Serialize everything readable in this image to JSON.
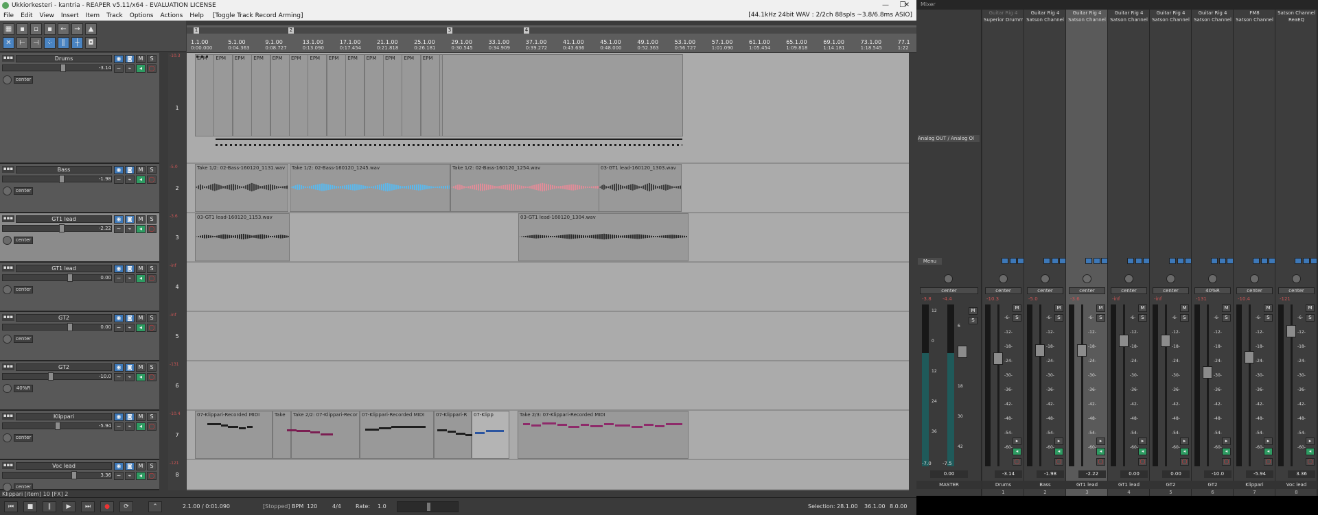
{
  "window": {
    "title": "Ukkiorkesteri - kantria - REAPER v5.11/x64 - EVALUATION LICENSE",
    "status": "[44.1kHz 24bit WAV : 2/2ch 88spls ~3.8/6.8ms ASIO]",
    "minimize": "—",
    "restore": "❐",
    "close": "✕"
  },
  "menu": {
    "items": [
      "File",
      "Edit",
      "View",
      "Insert",
      "Item",
      "Track",
      "Options",
      "Actions",
      "Help"
    ],
    "arming": "[Toggle Track Record Arming]"
  },
  "toolbar": {
    "icons": [
      "grid-icon",
      "save-icon",
      "open-icon",
      "new-icon",
      "undo-icon",
      "redo-icon",
      "metronome-icon",
      "ripple-icon",
      "snap-icon",
      "lock-icon",
      "group-icon",
      "envelope-icon",
      "crosshair-icon",
      "split-icon"
    ]
  },
  "ruler": {
    "markers": [
      "1",
      "2",
      "3",
      "4"
    ],
    "ticks": [
      {
        "bar": "1.1.00",
        "time": "0:00.000"
      },
      {
        "bar": "5.1.00",
        "time": "0:04.363"
      },
      {
        "bar": "9.1.00",
        "time": "0:08.727"
      },
      {
        "bar": "13.1.00",
        "time": "0:13.090"
      },
      {
        "bar": "17.1.00",
        "time": "0:17.454"
      },
      {
        "bar": "21.1.00",
        "time": "0:21.818"
      },
      {
        "bar": "25.1.00",
        "time": "0:26.181"
      },
      {
        "bar": "29.1.00",
        "time": "0:30.545"
      },
      {
        "bar": "33.1.00",
        "time": "0:34.909"
      },
      {
        "bar": "37.1.00",
        "time": "0:39.272"
      },
      {
        "bar": "41.1.00",
        "time": "0:43.636"
      },
      {
        "bar": "45.1.00",
        "time": "0:48.000"
      },
      {
        "bar": "49.1.00",
        "time": "0:52.363"
      },
      {
        "bar": "53.1.00",
        "time": "0:56.727"
      },
      {
        "bar": "57.1.00",
        "time": "1:01.090"
      },
      {
        "bar": "61.1.00",
        "time": "1:05.454"
      },
      {
        "bar": "65.1.00",
        "time": "1:09.818"
      },
      {
        "bar": "69.1.00",
        "time": "1:14.181"
      },
      {
        "bar": "73.1.00",
        "time": "1:18.545"
      },
      {
        "bar": "77.1",
        "time": "1:22"
      }
    ]
  },
  "tracks": [
    {
      "name": "Drums",
      "vol": "-3.14",
      "pan": "center",
      "num": "1",
      "peak": "-10.3",
      "lane_h": 162
    },
    {
      "name": "Bass",
      "vol": "-1.98",
      "pan": "center",
      "num": "2",
      "peak": "-5.0",
      "lane_h": 72
    },
    {
      "name": "GT1 lead",
      "vol": "-2.22",
      "pan": "center",
      "num": "3",
      "peak": "-3.6",
      "lane_h": 72
    },
    {
      "name": "GT1 lead",
      "vol": "0.00",
      "pan": "center",
      "num": "4",
      "peak": "-inf",
      "lane_h": 72
    },
    {
      "name": "GT2",
      "vol": "0.00",
      "pan": "center",
      "num": "5",
      "peak": "-inf",
      "lane_h": 72
    },
    {
      "name": "GT2",
      "vol": "-10.0",
      "pan": "40%R",
      "num": "6",
      "peak": "-131",
      "lane_h": 72
    },
    {
      "name": "Klippari",
      "vol": "-5.94",
      "pan": "center",
      "num": "7",
      "peak": "-10.4",
      "lane_h": 72
    },
    {
      "name": "Voc lead",
      "vol": "3.36",
      "pan": "center",
      "num": "8",
      "peak": "-121",
      "lane_h": 44
    }
  ],
  "items": {
    "drums_label": "EPM",
    "bass": [
      "Take 1/2: 02-Bass-160120_1131.wav",
      "Take 1/2: 02-Bass-160120_1245.wav",
      "Take 1/2: 02-Bass-160120_1254.wav",
      "03-GT1 lead-160120_1303.wav"
    ],
    "gt1": [
      "03-GT1 lead-160120_1153.wav",
      "03-GT1 lead-160120_1304.wav"
    ],
    "klippari": [
      "07-Klippari-Recorded MIDI",
      "Take",
      "Take 2/2: 07-Klippari-Recor",
      "07-Klippari-Recorded MIDI",
      "07-Klippari-R",
      "07-Klipp",
      "Take 2/3: 07-Klippari-Recorded MIDI"
    ]
  },
  "tcp_meter_nums": [
    "1",
    "2",
    "3",
    "4",
    "5",
    "6",
    "7",
    "8"
  ],
  "tcp_meter_peaks": [
    "-10.3",
    "-5.0",
    "-3.6",
    "-inf",
    "-inf",
    "-131",
    "-10.4",
    "-121"
  ],
  "transport": {
    "position": "2.1.00 / 0:01.090",
    "state": "[Stopped]",
    "bpm_label": "BPM",
    "bpm": "120",
    "timesig": "4/4",
    "rate_label": "Rate:",
    "rate": "1.0",
    "selection_label": "Selection:",
    "sel_start": "28.1.00",
    "sel_end": "36.1.00",
    "sel_len": "8.0.00"
  },
  "status_line": "Klippari [item] 10 [FX] 2",
  "mixer": {
    "title": "Mixer",
    "master": {
      "name": "MASTER",
      "vol": "0.00",
      "pan": "center",
      "peaks": [
        "-3.8",
        "-4.4"
      ],
      "bottom": [
        "-7.0",
        "-7.5"
      ],
      "io": "Analog OUT / Analog Ol"
    },
    "menu_btn": "Menu",
    "fx_rows": [
      [
        "Guitar Rig 4",
        "Superior Drumm"
      ],
      [
        "Guitar Rig 4",
        "Satson Channel"
      ],
      [
        "Guitar Rig 4",
        "Satson Channel"
      ],
      [
        "Guitar Rig 4",
        "Satson Channel"
      ],
      [
        "Guitar Rig 4",
        "Satson Channel"
      ],
      [
        "Guitar Rig 4",
        "Satson Channel"
      ],
      [
        "FM8",
        "Satson Channel"
      ],
      [
        "Satson Channel",
        "ReaEQ"
      ]
    ],
    "scale": [
      "-6-",
      "-12-",
      "-18-",
      "-24-",
      "-30-",
      "-36-",
      "-42-",
      "-48-",
      "-54-",
      "-60-"
    ],
    "master_scale": [
      "12",
      "6",
      "0",
      "6",
      "12",
      "18",
      "24",
      "30",
      "36",
      "42"
    ]
  },
  "colors": {
    "bass_blue": "#5bb8ec",
    "bass_red": "#e08c98",
    "midi_purple": "#8e2a6a",
    "accent_blue": "#3d78b8",
    "green": "#2e9b62"
  }
}
